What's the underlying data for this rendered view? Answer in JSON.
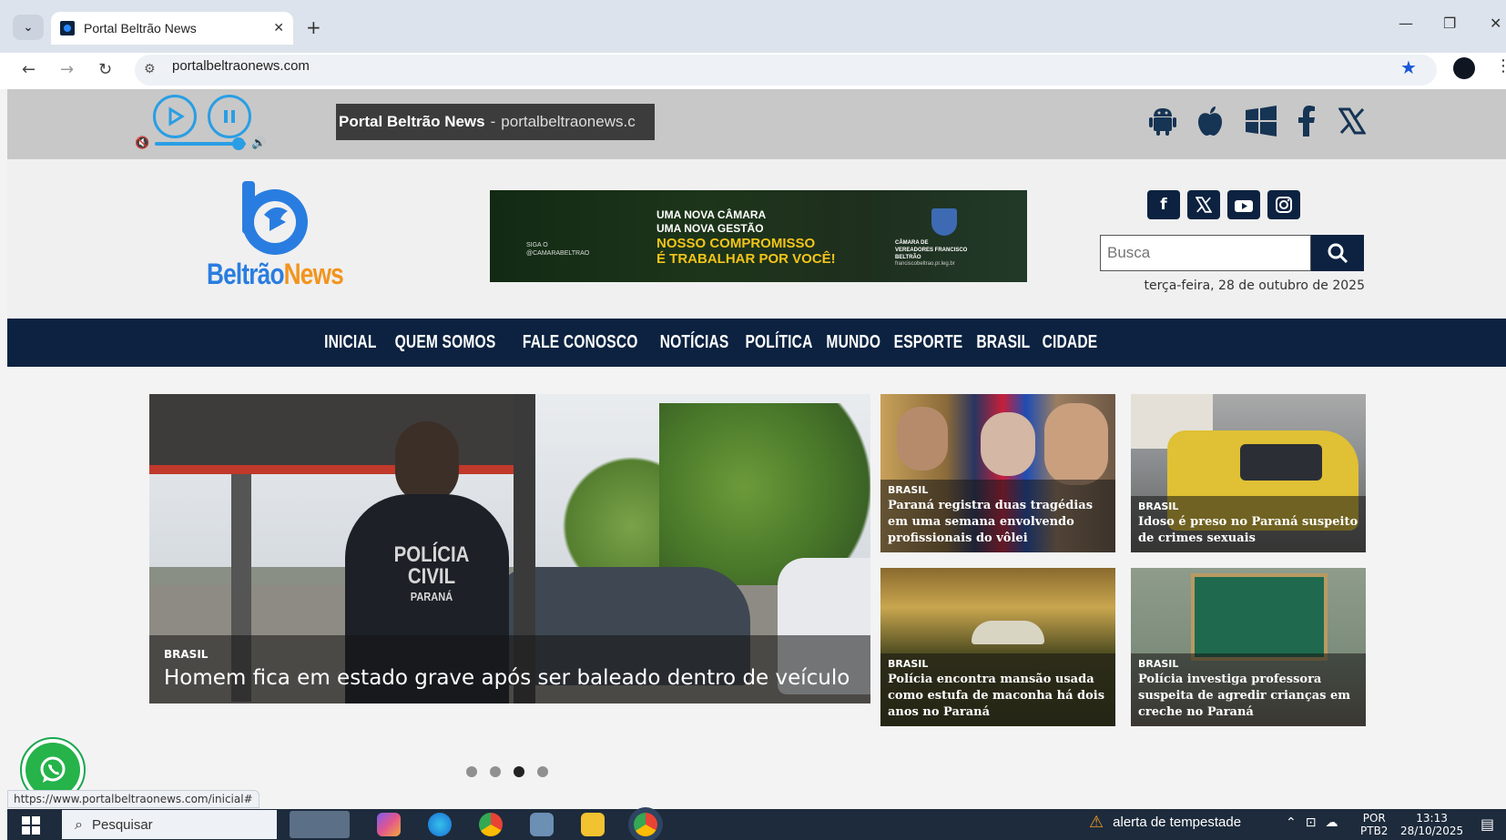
{
  "browser": {
    "tab_title": "Portal Beltrão News",
    "url": "portalbeltraonews.com",
    "status_url": "https://www.portalbeltraonews.com/inicial#",
    "icons": [
      "tab-dropdown-icon",
      "close-icon",
      "plus-icon",
      "back-icon",
      "forward-icon",
      "reload-icon",
      "site-settings-icon",
      "star-icon",
      "profile-icon",
      "menu-icon",
      "minimize-icon",
      "restore-icon",
      "window-close-icon"
    ]
  },
  "radio": {
    "marquee_title": "Portal Beltrão News",
    "marquee_sep": "-",
    "marquee_domain": "portalbeltraonews.c",
    "volume_level": 0.92,
    "icons": [
      "play-icon",
      "pause-icon",
      "mute-icon",
      "volume-icon",
      "android-icon",
      "apple-icon",
      "windows-icon",
      "facebook-icon",
      "x-icon"
    ]
  },
  "header": {
    "logo_text_1": "Beltrão",
    "logo_text_2": "News",
    "banner": {
      "line1": "UMA NOVA CÂMARA",
      "line2": "UMA NOVA GESTÃO",
      "line3": "NOSSO COMPROMISSO",
      "line4": "É TRABALHAR POR VOCÊ!",
      "siga": "SIGA O @CAMARABELTRAO",
      "camara": "CÂMARA DE VEREADORES FRANCISCO BELTRÃO",
      "site": "franciscobeltrao.pr.leg.br"
    },
    "social_icons": [
      "facebook-icon",
      "x-icon",
      "youtube-icon",
      "instagram-icon"
    ],
    "search_placeholder": "Busca",
    "date": "terça-feira, 28 de outubro de 2025"
  },
  "menu": [
    "INICIAL",
    "QUEM SOMOS",
    "FALE CONOSCO",
    "NOTÍCIAS",
    "POLÍTICA",
    "MUNDO",
    "ESPORTE",
    "BRASIL",
    "CIDADE"
  ],
  "hero": {
    "category": "BRASIL",
    "title": "Homem fica em estado grave após ser baleado dentro de veículo",
    "vest_line1": "POLÍCIA",
    "vest_line2": "CIVIL",
    "vest_line3": "PARANÁ"
  },
  "cards": [
    {
      "category": "BRASIL",
      "title": "Paraná registra duas tragédias em uma semana envolvendo profissionais do vôlei"
    },
    {
      "category": "BRASIL",
      "title": "Idoso é preso no Paraná suspeito de crimes sexuais"
    },
    {
      "category": "BRASIL",
      "title": "Polícia encontra mansão usada como estufa de maconha há dois anos no Paraná"
    },
    {
      "category": "BRASIL",
      "title": "Polícia investiga professora suspeita de agredir crianças em creche no Paraná"
    }
  ],
  "slider": {
    "count": 4,
    "active": 3
  },
  "taskbar": {
    "search_text": "Pesquisar",
    "alert_text": "alerta de tempestade",
    "lang_1": "POR",
    "lang_2": "PTB2",
    "time": "13:13",
    "date": "28/10/2025"
  }
}
